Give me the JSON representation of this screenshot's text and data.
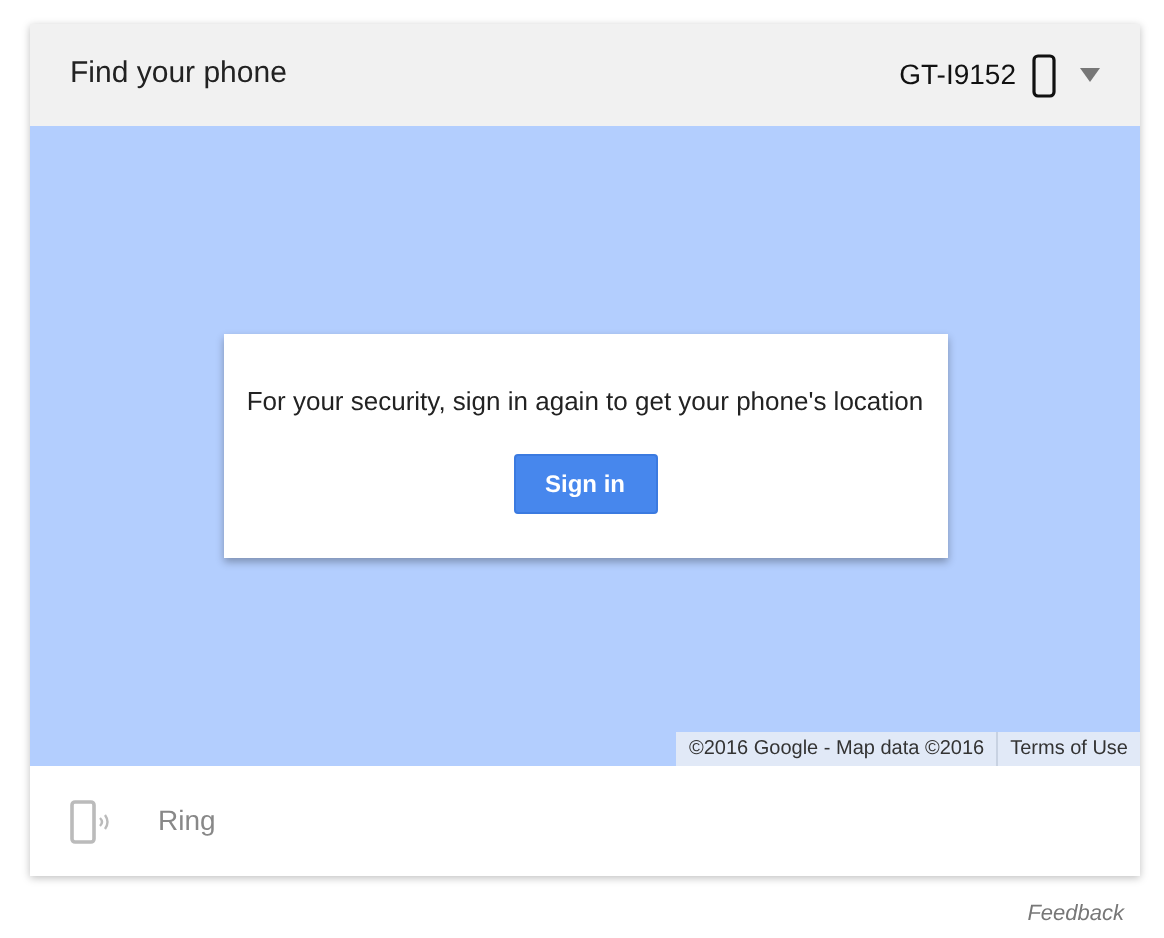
{
  "header": {
    "title": "Find your phone",
    "device": "GT-I9152"
  },
  "map": {
    "message": "For your security, sign in again to get your phone's location",
    "button": "Sign in",
    "attribution": "©2016 Google - Map data ©2016",
    "terms": "Terms of Use"
  },
  "actions": [
    {
      "label": "Ring",
      "disabled": true
    }
  ],
  "feedback": "Feedback"
}
